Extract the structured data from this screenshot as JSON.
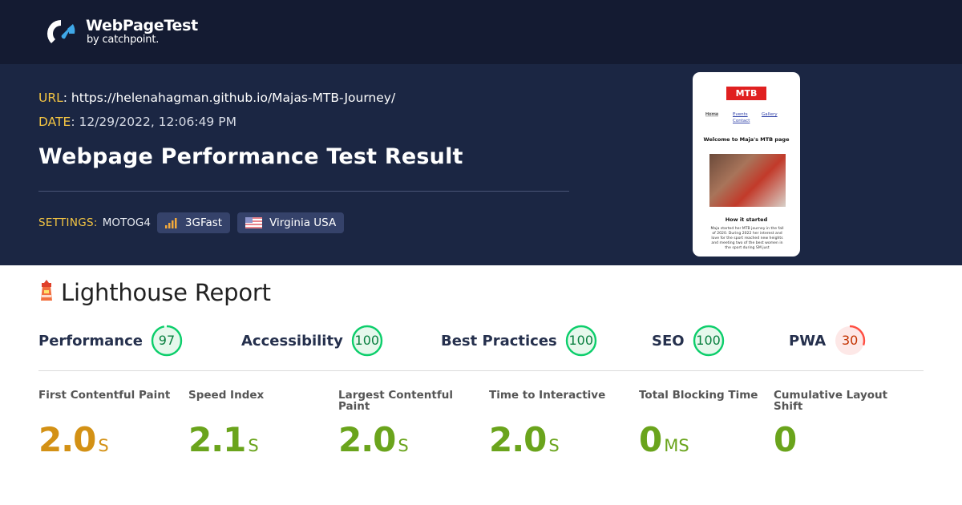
{
  "brand": {
    "name": "WebPageTest",
    "sub": "by catchpoint."
  },
  "meta": {
    "url_key": "URL",
    "url_value": "https://helenahagman.github.io/Majas-MTB-Journey/",
    "date_key": "DATE",
    "date_value": "12/29/2022, 12:06:49 PM"
  },
  "title": "Webpage Performance Test Result",
  "settings": {
    "key": "SETTINGS:",
    "device": "MOTOG4",
    "connection": "3GFast",
    "location": "Virginia USA"
  },
  "thumbnail": {
    "logo_text": "MTB",
    "nav": [
      "Home",
      "Events",
      "Gallery",
      "Contact"
    ],
    "heading": "Welcome to Maja's MTB page",
    "subheading": "How it started",
    "paragraph": "Maja started her MTB journey in the fall of 2020. During 2022 her interest and love for the sport reached new heights and meeting two of the best women in the sport during SM just"
  },
  "lighthouse": {
    "heading": "Lighthouse Report",
    "categories": [
      {
        "label": "Performance",
        "score": "97",
        "color": "#0cce6b"
      },
      {
        "label": "Accessibility",
        "score": "100",
        "color": "#0cce6b"
      },
      {
        "label": "Best Practices",
        "score": "100",
        "color": "#0cce6b"
      },
      {
        "label": "SEO",
        "score": "100",
        "color": "#0cce6b"
      },
      {
        "label": "PWA",
        "score": "30",
        "color": "#ff4e42"
      }
    ],
    "metrics": [
      {
        "label": "First Contentful Paint",
        "value": "2.0",
        "unit": "S",
        "color": "#d39115"
      },
      {
        "label": "Speed Index",
        "value": "2.1",
        "unit": "S",
        "color": "#6aa41c"
      },
      {
        "label": "Largest Contentful Paint",
        "value": "2.0",
        "unit": "S",
        "color": "#6aa41c"
      },
      {
        "label": "Time to Interactive",
        "value": "2.0",
        "unit": "S",
        "color": "#6aa41c"
      },
      {
        "label": "Total Blocking Time",
        "value": "0",
        "unit": "MS",
        "color": "#6aa41c"
      },
      {
        "label": "Cumulative Layout Shift",
        "value": "0",
        "unit": "",
        "color": "#6aa41c"
      }
    ]
  }
}
